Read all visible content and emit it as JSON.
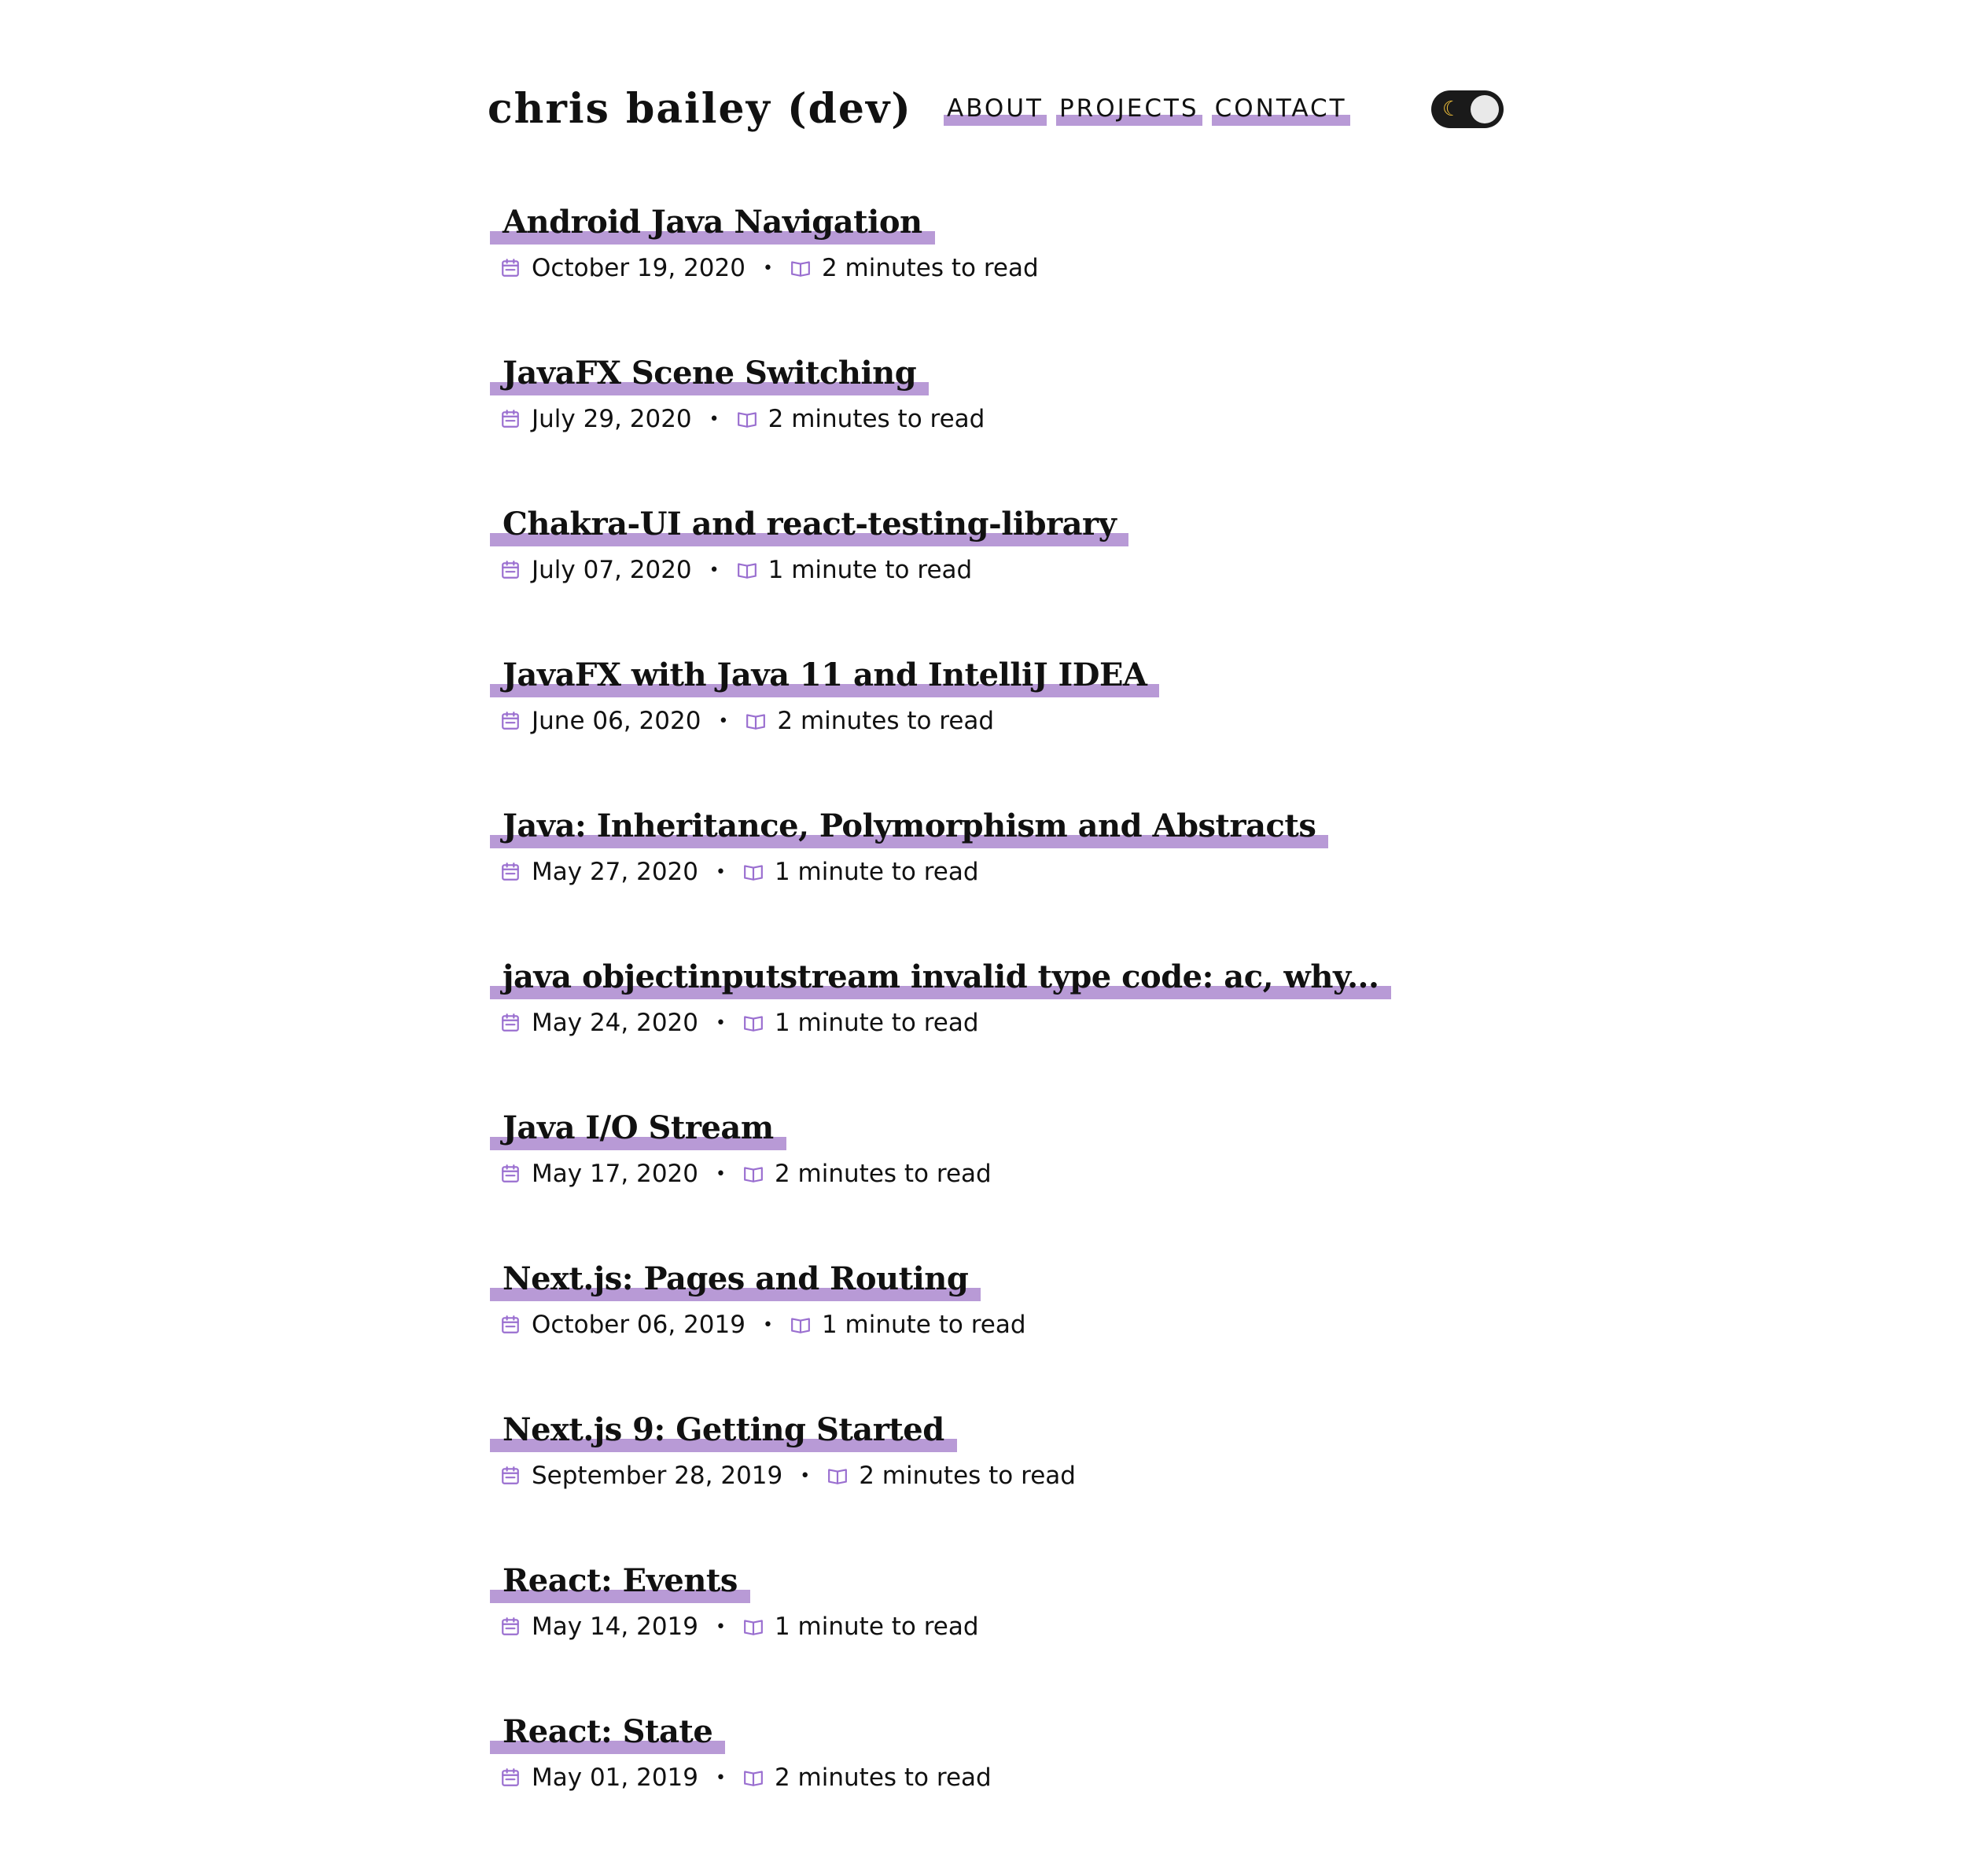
{
  "header": {
    "site_title": "chris bailey (dev)",
    "nav": [
      {
        "label": "ABOUT"
      },
      {
        "label": "PROJECTS"
      },
      {
        "label": "CONTACT"
      }
    ],
    "theme_toggle": {
      "icon": "moon-icon",
      "state": "dark"
    }
  },
  "colors": {
    "accent": "#b89ad6",
    "text": "#111111",
    "toggle_bg": "#1a1a1a",
    "moon": "#f3c23a"
  },
  "posts": [
    {
      "title": "Android Java Navigation",
      "date": "October 19, 2020",
      "read_time": "2 minutes to read"
    },
    {
      "title": "JavaFX Scene Switching",
      "date": "July 29, 2020",
      "read_time": "2 minutes to read"
    },
    {
      "title": "Chakra-UI and react-testing-library",
      "date": "July 07, 2020",
      "read_time": "1 minute to read"
    },
    {
      "title": "JavaFX with Java 11 and IntelliJ IDEA",
      "date": "June 06, 2020",
      "read_time": "2 minutes to read"
    },
    {
      "title": "Java: Inheritance, Polymorphism and Abstracts",
      "date": "May 27, 2020",
      "read_time": "1 minute to read"
    },
    {
      "title": "java objectinputstream invalid type code: ac, why...",
      "date": "May 24, 2020",
      "read_time": "1 minute to read"
    },
    {
      "title": "Java I/O Stream",
      "date": "May 17, 2020",
      "read_time": "2 minutes to read"
    },
    {
      "title": "Next.js: Pages and Routing",
      "date": "October 06, 2019",
      "read_time": "1 minute to read"
    },
    {
      "title": "Next.js 9: Getting Started",
      "date": "September 28, 2019",
      "read_time": "2 minutes to read"
    },
    {
      "title": "React: Events",
      "date": "May 14, 2019",
      "read_time": "1 minute to read"
    },
    {
      "title": "React: State",
      "date": "May 01, 2019",
      "read_time": "2 minutes to read"
    }
  ]
}
